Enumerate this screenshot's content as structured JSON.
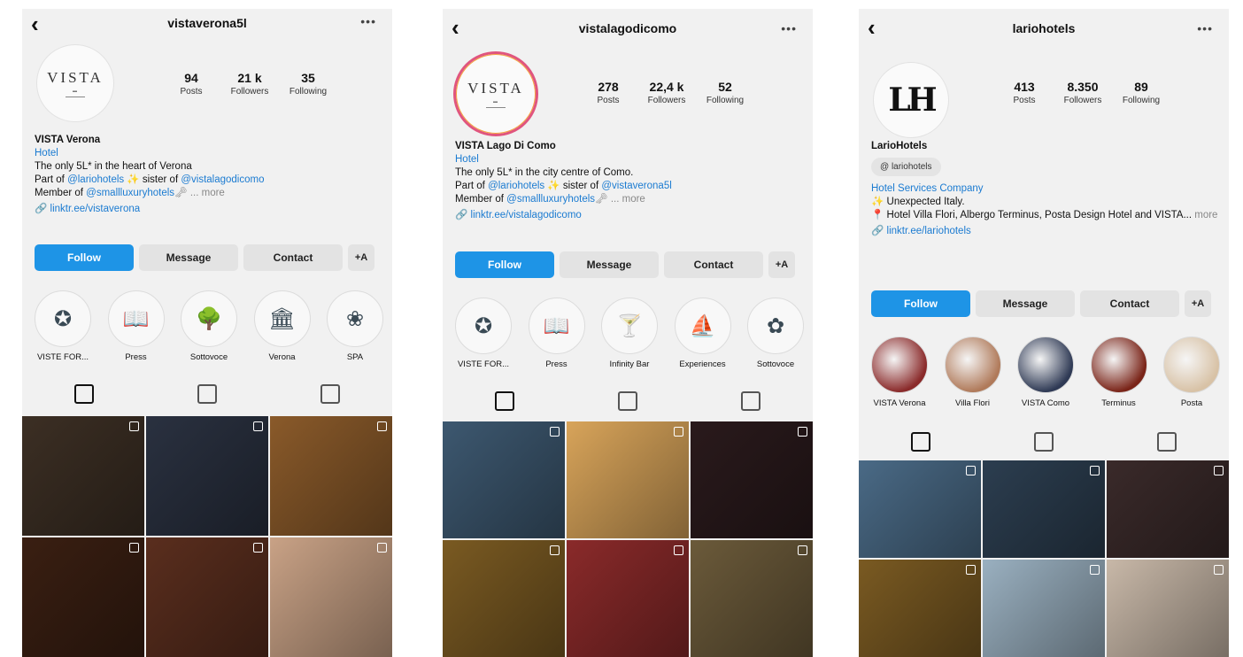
{
  "profiles": [
    {
      "username": "vistaverona5l",
      "posts": "94",
      "posts_label": "Posts",
      "followers": "21 k",
      "followers_label": "Followers",
      "following": "35",
      "following_label": "Following",
      "display_name": "VISTA Verona",
      "category": "Hotel",
      "bio1": "The only 5L* in the heart of Verona",
      "bio2_a": "Part of ",
      "bio2_link1": "@lariohotels",
      "bio2_b": " ✨ sister of ",
      "bio2_link2": "@vistalagodicomo",
      "bio3_a": "Member of ",
      "bio3_link": "@smallluxuryhotels",
      "bio3_more": "🗝 ... more",
      "website": "🔗 linktr.ee/vistaverona",
      "follow_btn": "Follow",
      "message_btn": "Message",
      "contact_btn": "Contact",
      "add_btn": "+A",
      "highlights": [
        {
          "label": "VISTE FOR...",
          "icon": "vista-seal-icon",
          "glyph": "✪"
        },
        {
          "label": "Press",
          "icon": "book-icon",
          "glyph": "📖"
        },
        {
          "label": "Sottovoce",
          "icon": "tree-icon",
          "glyph": "🌳"
        },
        {
          "label": "Verona",
          "icon": "arena-icon",
          "glyph": "🏛"
        },
        {
          "label": "SPA",
          "icon": "lotus-icon",
          "glyph": "❀"
        }
      ],
      "tiles": [
        "#3c2f24",
        "#2a3140",
        "#8a5a2a",
        "#3a1f12",
        "#5a2e1e",
        "#c9a286"
      ]
    },
    {
      "username": "vistalagodicomo",
      "posts": "278",
      "posts_label": "Posts",
      "followers": "22,4 k",
      "followers_label": "Followers",
      "following": "52",
      "following_label": "Following",
      "display_name": "VISTA Lago Di Como",
      "category": "Hotel",
      "bio1": "The only 5L* in the city centre of Como.",
      "bio2_a": "Part of ",
      "bio2_link1": "@lariohotels",
      "bio2_b": " ✨ sister of ",
      "bio2_link2": "@vistaverona5l",
      "bio3_a": "Member of ",
      "bio3_link": "@smallluxuryhotels",
      "bio3_more": "🗝 ... more",
      "website": "🔗 linktr.ee/vistalagodicomo",
      "follow_btn": "Follow",
      "message_btn": "Message",
      "contact_btn": "Contact",
      "add_btn": "+A",
      "highlights": [
        {
          "label": "VISTE FOR...",
          "icon": "vista-seal-icon",
          "glyph": "✪"
        },
        {
          "label": "Press",
          "icon": "book-icon",
          "glyph": "📖"
        },
        {
          "label": "Infinity Bar",
          "icon": "cocktail-icon",
          "glyph": "🍸"
        },
        {
          "label": "Experiences",
          "icon": "boat-icon",
          "glyph": "⛵"
        },
        {
          "label": "Sottovoce",
          "icon": "flower-icon",
          "glyph": "✿"
        }
      ],
      "tiles": [
        "#3d5870",
        "#d8a45a",
        "#2a1a1c",
        "#7a5a22",
        "#8a2a2a",
        "#6b5a3a"
      ]
    },
    {
      "username": "lariohotels",
      "posts": "413",
      "posts_label": "Posts",
      "followers": "8.350",
      "followers_label": "Followers",
      "following": "89",
      "following_label": "Following",
      "display_name": "LarioHotels",
      "tag": "lariohotels",
      "category": "Hotel Services Company",
      "bio1": "✨ Unexpected Italy.",
      "bio2": "📍 Hotel Villa Flori, Albergo Terminus, Posta Design Hotel and VISTA...",
      "bio2_more": " more",
      "website": "🔗 linktr.ee/lariohotels",
      "follow_btn": "Follow",
      "message_btn": "Message",
      "contact_btn": "Contact",
      "add_btn": "+A",
      "highlights": [
        {
          "label": "VISTA Verona",
          "icon": "photo-icon",
          "color": "#8a2a2a"
        },
        {
          "label": "Villa Flori",
          "icon": "photo-icon",
          "color": "#b07a5a"
        },
        {
          "label": "VISTA Como",
          "icon": "photo-icon",
          "color": "#2f3a55"
        },
        {
          "label": "Terminus",
          "icon": "photo-icon",
          "color": "#7a2418"
        },
        {
          "label": "Posta",
          "icon": "photo-icon",
          "color": "#d8c2a6"
        }
      ],
      "tiles": [
        "#4a6a86",
        "#2c3e50",
        "#3a2a2a",
        "#7a5a22",
        "#9ab0c0",
        "#c8b8a8"
      ]
    }
  ]
}
